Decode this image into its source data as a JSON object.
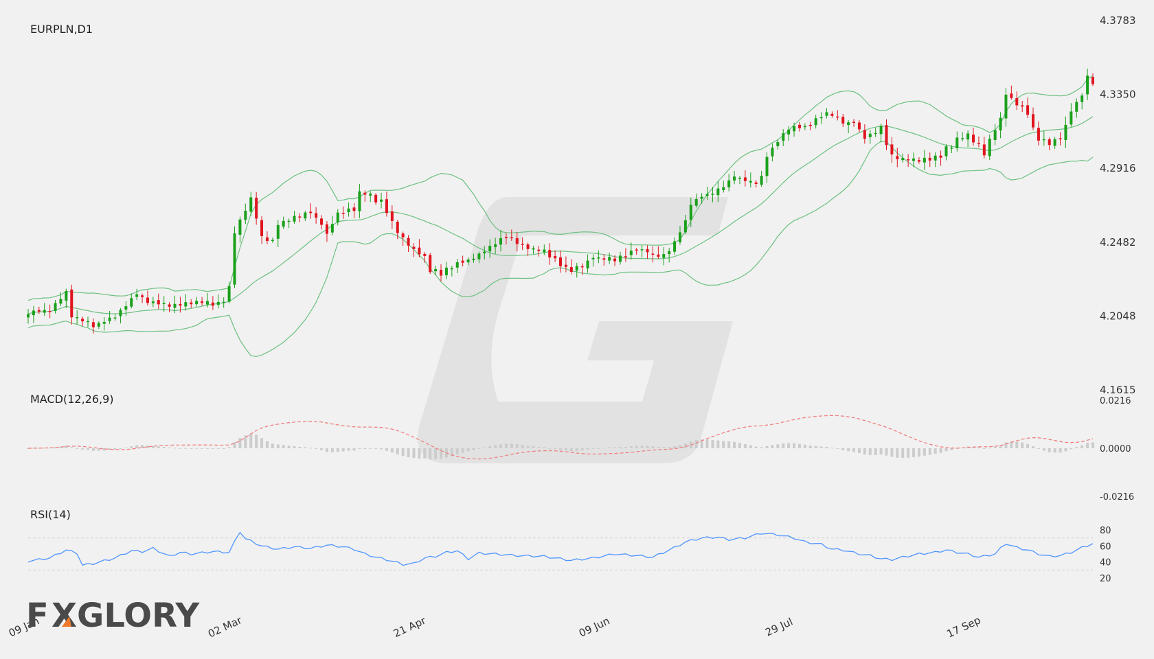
{
  "chart_data": {
    "type": "candlestick",
    "symbol_label": "EURPLN,D1",
    "x_tick_labels": [
      "09 Jan",
      "02 Mar",
      "21 Apr",
      "09 Jun",
      "29 Jul",
      "17 Sep"
    ],
    "x_tick_index": [
      0,
      37,
      71,
      105,
      139,
      173
    ],
    "price_axis": {
      "ticks": [
        "4.3783",
        "4.3350",
        "4.2916",
        "4.2482",
        "4.2048",
        "4.1615"
      ],
      "range": [
        4.1615,
        4.3783
      ]
    },
    "colors": {
      "up": "#1aa01a",
      "down": "#e0141e",
      "bands": "#6cc080",
      "macd_signal": "#f08080",
      "macd_hist": "#cccccc",
      "rsi": "#4f95ff"
    },
    "anchor_close": [
      [
        0,
        4.2068
      ],
      [
        4,
        4.2085
      ],
      [
        7,
        4.2182
      ],
      [
        8,
        4.205
      ],
      [
        12,
        4.1993
      ],
      [
        16,
        4.205
      ],
      [
        20,
        4.2179
      ],
      [
        23,
        4.212
      ],
      [
        28,
        4.2116
      ],
      [
        31,
        4.2134
      ],
      [
        34,
        4.2116
      ],
      [
        36,
        4.214
      ],
      [
        37,
        4.222
      ],
      [
        38,
        4.2536
      ],
      [
        41,
        4.274
      ],
      [
        43,
        4.2504
      ],
      [
        45,
        4.2482
      ],
      [
        46,
        4.259
      ],
      [
        49,
        4.263
      ],
      [
        52,
        4.2655
      ],
      [
        54,
        4.2591
      ],
      [
        55,
        4.253
      ],
      [
        57,
        4.265
      ],
      [
        60,
        4.268
      ],
      [
        61,
        4.2776
      ],
      [
        63,
        4.276
      ],
      [
        64,
        4.2722
      ],
      [
        65,
        4.272
      ],
      [
        66,
        4.266
      ],
      [
        68,
        4.254
      ],
      [
        71,
        4.244
      ],
      [
        73,
        4.239
      ],
      [
        74,
        4.232
      ],
      [
        76,
        4.23
      ],
      [
        78,
        4.234
      ],
      [
        80,
        4.237
      ],
      [
        82,
        4.239
      ],
      [
        84,
        4.243
      ],
      [
        86,
        4.248
      ],
      [
        88,
        4.251
      ],
      [
        90,
        4.2472
      ],
      [
        93,
        4.244
      ],
      [
        95,
        4.2424
      ],
      [
        98,
        4.235
      ],
      [
        100,
        4.231
      ],
      [
        102,
        4.235
      ],
      [
        104,
        4.239
      ],
      [
        106,
        4.239
      ],
      [
        108,
        4.238
      ],
      [
        110,
        4.24
      ],
      [
        112,
        4.244
      ],
      [
        113,
        4.244
      ],
      [
        115,
        4.241
      ],
      [
        117,
        4.24
      ],
      [
        119,
        4.2485
      ],
      [
        121,
        4.261
      ],
      [
        122,
        4.2706
      ],
      [
        124,
        4.275
      ],
      [
        126,
        4.277
      ],
      [
        128,
        4.2816
      ],
      [
        130,
        4.287
      ],
      [
        132,
        4.285
      ],
      [
        134,
        4.283
      ],
      [
        135,
        4.287
      ],
      [
        136,
        4.299
      ],
      [
        138,
        4.307
      ],
      [
        140,
        4.315
      ],
      [
        142,
        4.3156
      ],
      [
        143,
        4.315
      ],
      [
        145,
        4.32
      ],
      [
        147,
        4.324
      ],
      [
        148,
        4.3225
      ],
      [
        150,
        4.318
      ],
      [
        152,
        4.319
      ],
      [
        154,
        4.309
      ],
      [
        156,
        4.313
      ],
      [
        157,
        4.316
      ],
      [
        158,
        4.306
      ],
      [
        159,
        4.2984
      ],
      [
        161,
        4.297
      ],
      [
        163,
        4.296
      ],
      [
        165,
        4.297
      ],
      [
        168,
        4.2985
      ],
      [
        169,
        4.303
      ],
      [
        170,
        4.305
      ],
      [
        171,
        4.309
      ],
      [
        173,
        4.311
      ],
      [
        174,
        4.308
      ],
      [
        175,
        4.305
      ],
      [
        176,
        4.3
      ],
      [
        178,
        4.315
      ],
      [
        179,
        4.32
      ],
      [
        180,
        4.3355
      ],
      [
        182,
        4.33
      ],
      [
        184,
        4.324
      ],
      [
        185,
        4.315
      ],
      [
        186,
        4.309
      ],
      [
        188,
        4.306
      ],
      [
        190,
        4.31
      ],
      [
        191,
        4.316
      ],
      [
        192,
        4.325
      ],
      [
        194,
        4.335
      ],
      [
        195,
        4.3445
      ],
      [
        196,
        4.342
      ]
    ],
    "macd": {
      "label": "MACD(12,26,9)",
      "ticks": [
        "0.0216",
        "0.0000",
        "-0.0216"
      ],
      "range": [
        -0.0216,
        0.0216
      ]
    },
    "rsi": {
      "label": "RSI(14)",
      "ticks": [
        "80",
        "60",
        "40",
        "20"
      ],
      "range": [
        20,
        80
      ],
      "levels": [
        70,
        30
      ],
      "anchors": [
        [
          0,
          41
        ],
        [
          4,
          45
        ],
        [
          7,
          55
        ],
        [
          9,
          51
        ],
        [
          10,
          36
        ],
        [
          12,
          38
        ],
        [
          16,
          45
        ],
        [
          19,
          54
        ],
        [
          21,
          53
        ],
        [
          23,
          57
        ],
        [
          26,
          47
        ],
        [
          28,
          52
        ],
        [
          30,
          50
        ],
        [
          34,
          53
        ],
        [
          37,
          52
        ],
        [
          38,
          65
        ],
        [
          39,
          78
        ],
        [
          40,
          69
        ],
        [
          43,
          60
        ],
        [
          46,
          56
        ],
        [
          49,
          59
        ],
        [
          52,
          57
        ],
        [
          55,
          61
        ],
        [
          58,
          59
        ],
        [
          60,
          56
        ],
        [
          62,
          50
        ],
        [
          64,
          46
        ],
        [
          66,
          43
        ],
        [
          69,
          37
        ],
        [
          71,
          38
        ],
        [
          73,
          45
        ],
        [
          75,
          47
        ],
        [
          77,
          52
        ],
        [
          79,
          54
        ],
        [
          81,
          44
        ],
        [
          83,
          51
        ],
        [
          86,
          50
        ],
        [
          90,
          48
        ],
        [
          95,
          47
        ],
        [
          98,
          44
        ],
        [
          100,
          42
        ],
        [
          104,
          45
        ],
        [
          108,
          50
        ],
        [
          112,
          48
        ],
        [
          115,
          46
        ],
        [
          119,
          58
        ],
        [
          121,
          65
        ],
        [
          124,
          70
        ],
        [
          127,
          71
        ],
        [
          129,
          68
        ],
        [
          132,
          70
        ],
        [
          135,
          76
        ],
        [
          138,
          74
        ],
        [
          141,
          70
        ],
        [
          143,
          65
        ],
        [
          146,
          62
        ],
        [
          148,
          56
        ],
        [
          150,
          55
        ],
        [
          153,
          50
        ],
        [
          155,
          48
        ],
        [
          157,
          44
        ],
        [
          159,
          43
        ],
        [
          161,
          46
        ],
        [
          164,
          50
        ],
        [
          167,
          52
        ],
        [
          169,
          55
        ],
        [
          171,
          52
        ],
        [
          173,
          50
        ],
        [
          175,
          46
        ],
        [
          178,
          50
        ],
        [
          179,
          57
        ],
        [
          180,
          63
        ],
        [
          182,
          58
        ],
        [
          184,
          55
        ],
        [
          186,
          50
        ],
        [
          188,
          47
        ],
        [
          190,
          48
        ],
        [
          192,
          52
        ],
        [
          194,
          58
        ],
        [
          196,
          63
        ]
      ]
    }
  },
  "logo": {
    "text_a": "F",
    "text_b": "XGLORY",
    "accent": "#f07a2a"
  }
}
